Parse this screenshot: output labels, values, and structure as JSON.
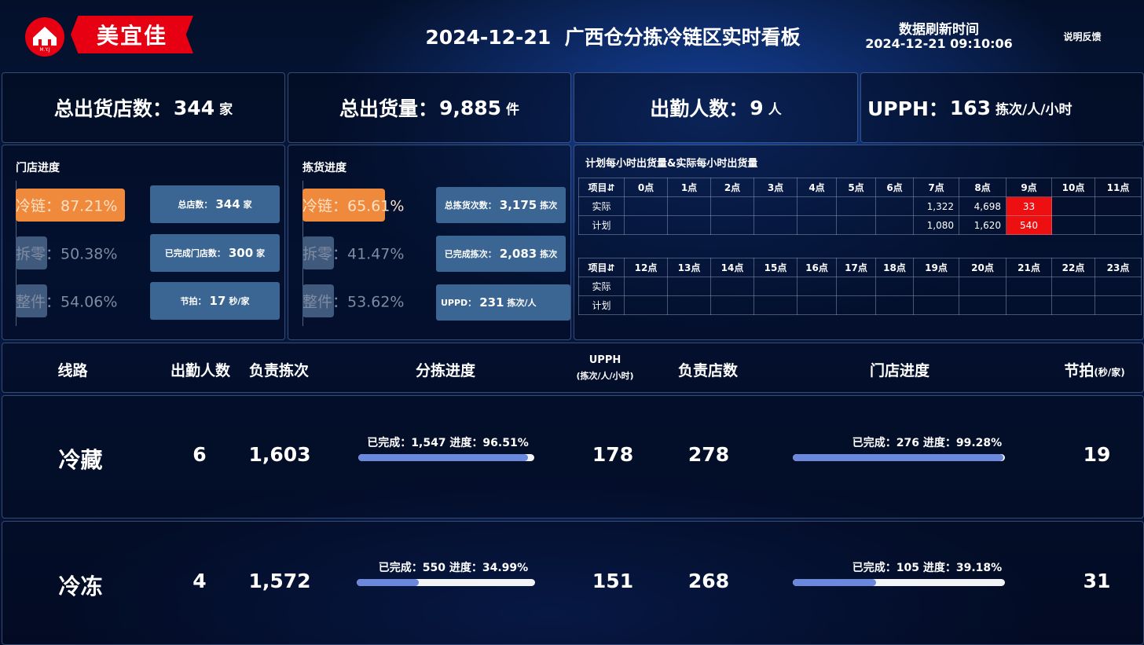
{
  "header": {
    "logo_text": "美宜佳",
    "logo_sub": "M.Y.J",
    "date": "2024-12-21",
    "title": "广西仓分拣冷链区实时看板",
    "refresh_label": "数据刷新时间",
    "refresh_time": "2024-12-21 09:10:06",
    "feedback": "说明反馈"
  },
  "kpis": [
    {
      "label": "总出货店数：",
      "value": "344",
      "unit": "家"
    },
    {
      "label": "总出货量：",
      "value": "9,885",
      "unit": "件"
    },
    {
      "label": "出勤人数：",
      "value": "9",
      "unit": "人"
    },
    {
      "label": "UPPH：",
      "value": "163",
      "unit": "拣次/人/小时"
    }
  ],
  "store_progress": {
    "title": "门店进度",
    "bars": [
      {
        "label": "冷链：87.21%",
        "value": 87.21,
        "active": true
      },
      {
        "label": "拆零：50.38%",
        "value": 50.38,
        "active": false
      },
      {
        "label": "整件：54.06%",
        "value": 54.06,
        "active": false
      }
    ],
    "stats": [
      {
        "label": "总店数：",
        "value": "344",
        "unit": "家"
      },
      {
        "label": "已完成门店数：",
        "value": "300",
        "unit": "家"
      },
      {
        "label": "节拍：",
        "value": "17",
        "unit": "秒/家"
      }
    ]
  },
  "pick_progress": {
    "title": "拣货进度",
    "bars": [
      {
        "label": "冷链：65.61%",
        "value": 65.61,
        "active": true
      },
      {
        "label": "拆零：41.47%",
        "value": 41.47,
        "active": false
      },
      {
        "label": "整件：53.62%",
        "value": 53.62,
        "active": false
      }
    ],
    "stats": [
      {
        "label": "总拣货次数：",
        "value": "3,175",
        "unit": "拣次"
      },
      {
        "label": "已完成拣次：",
        "value": "2,083",
        "unit": "拣次"
      },
      {
        "label": "UPPD：",
        "value": "231",
        "unit": "拣次/人"
      }
    ]
  },
  "hourly": {
    "title": "计划每小时出货量&实际每小时出货量",
    "corner": "项目⇵",
    "row_labels": [
      "实际",
      "计划"
    ],
    "hours_am": [
      "0点",
      "1点",
      "2点",
      "3点",
      "4点",
      "5点",
      "6点",
      "7点",
      "8点",
      "9点",
      "10点",
      "11点"
    ],
    "actual_am": [
      "",
      "",
      "",
      "",
      "",
      "",
      "",
      "1,322",
      "4,698",
      "33",
      "",
      ""
    ],
    "plan_am": [
      "",
      "",
      "",
      "",
      "",
      "",
      "",
      "1,080",
      "1,620",
      "540",
      "",
      ""
    ],
    "hours_pm": [
      "12点",
      "13点",
      "14点",
      "15点",
      "16点",
      "17点",
      "18点",
      "19点",
      "20点",
      "21点",
      "22点",
      "23点"
    ],
    "actual_pm": [
      "",
      "",
      "",
      "",
      "",
      "",
      "",
      "",
      "",
      "",
      "",
      ""
    ],
    "plan_pm": [
      "",
      "",
      "",
      "",
      "",
      "",
      "",
      "",
      "",
      "",
      "",
      ""
    ],
    "highlight_color": "#ee1010"
  },
  "lines_table": {
    "headers": {
      "line": "线路",
      "staff": "出勤人数",
      "picks": "负责拣次",
      "pick_progress": "分拣进度",
      "upph": "UPPH",
      "upph_unit": "(拣次/人/小时)",
      "stores": "负责店数",
      "store_progress": "门店进度",
      "beat": "节拍",
      "beat_unit": "(秒/家)"
    },
    "rows": [
      {
        "line": "冷藏",
        "staff": "6",
        "picks": "1,603",
        "pick_label": "已完成：1,547   进度：96.51%",
        "pick_pct": 96.51,
        "upph": "178",
        "stores": "278",
        "store_label": "已完成：276 进度：99.28%",
        "store_pct": 99.28,
        "beat": "19"
      },
      {
        "line": "冷冻",
        "staff": "4",
        "picks": "1,572",
        "pick_label": "已完成：550   进度：34.99%",
        "pick_pct": 34.99,
        "upph": "151",
        "stores": "268",
        "store_label": "已完成：105 进度：39.18%",
        "store_pct": 39.18,
        "beat": "31"
      }
    ]
  },
  "colors": {
    "brand_red": "#e60012",
    "active_bar": "#ef8a3d",
    "muted_bar": "#405a7e",
    "stat_box": "#3b6592",
    "progress_fill": "#6c88dd"
  }
}
